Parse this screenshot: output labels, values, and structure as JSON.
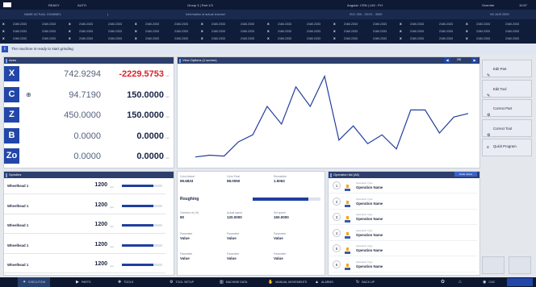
{
  "topbar": {
    "logo": "",
    "mode": "READY",
    "mode2": "AUTO",
    "group": "Group 3 | Part 1/3",
    "angular": "Angular: CRN | LIM : P.H",
    "override": "Override",
    "time": "10:57"
  },
  "subbar": {
    "name_actual": "NAME ACTUAL CHANNEL",
    "sep": "|",
    "info": "Information of actual channel",
    "iso": "ISO: 300 - XXXX - 3000",
    "nc": "NC AUS 0000"
  },
  "channels": {
    "x": "X",
    "value": "2160.2333"
  },
  "message": {
    "icon": "i",
    "text": "The machine is ready to start grinding"
  },
  "axes": {
    "title": "Axes",
    "rows": [
      {
        "label": "X",
        "v1": "742.9294",
        "v2": "-2229.5753",
        "red": true,
        "unit": "mm"
      },
      {
        "label": "C",
        "v1": "94.7190",
        "v2": "150.0000",
        "red": false,
        "unit": "mm",
        "icon": "⊕"
      },
      {
        "label": "Z",
        "v1": "450.0000",
        "v2": "150.0000",
        "red": false,
        "unit": "mm"
      },
      {
        "label": "B",
        "v1": "0.0000",
        "v2": "0.0000",
        "red": false,
        "unit": "mm"
      },
      {
        "label": "Zo",
        "v1": "0.0000",
        "v2": "0.0000",
        "red": false,
        "unit": "mm"
      }
    ]
  },
  "view": {
    "title": "View Options (1 screen)",
    "page": "2/6"
  },
  "chart_data": {
    "type": "line",
    "x": [
      1,
      2,
      3,
      4,
      5,
      6,
      7,
      8,
      9,
      10,
      11,
      12,
      13,
      14,
      15,
      16,
      17,
      18,
      19,
      20
    ],
    "values": [
      3,
      5,
      4,
      20,
      28,
      60,
      40,
      82,
      60,
      94,
      22,
      38,
      18,
      28,
      12,
      56,
      56,
      30,
      48,
      52
    ],
    "ylim": [
      0,
      100
    ]
  },
  "spindles": {
    "title": "Spindles",
    "rows": [
      {
        "name": "Wheelhead 1",
        "value": "1200",
        "unit": "rpm",
        "fill": 0.78
      },
      {
        "name": "Wheelhead 1",
        "value": "1200",
        "unit": "rpm",
        "fill": 0.78
      },
      {
        "name": "Wheelhead 1",
        "value": "1200",
        "unit": "rpm",
        "fill": 0.78
      },
      {
        "name": "Wheelhead 1",
        "value": "1200",
        "unit": "rpm",
        "fill": 0.78
      },
      {
        "name": "Wheelhead 1",
        "value": "1200",
        "unit": "rpm",
        "fill": 0.78
      }
    ]
  },
  "process": {
    "r1": [
      {
        "l": "Color Actual",
        "v": "99.6833"
      },
      {
        "l": "Color Final",
        "v": "98.0050"
      },
      {
        "l": "Remainder",
        "v": "1.5063"
      }
    ],
    "roughing": "Roughing",
    "rough_fill": 0.82,
    "r2": [
      {
        "l": "Overtrav rel (%)",
        "v": "80"
      },
      {
        "l": "Actual speed",
        "v": "120.0000"
      },
      {
        "l": "Set speed",
        "v": "150.0000"
      }
    ],
    "r3": [
      {
        "l": "Parameter",
        "v": "Value"
      },
      {
        "l": "Parameter",
        "v": "Value"
      },
      {
        "l": "Parameter",
        "v": "Value"
      }
    ],
    "r4": [
      {
        "l": "Parameter",
        "v": "Value"
      },
      {
        "l": "Parameter",
        "v": "Value"
      },
      {
        "l": "Parameter",
        "v": "Value"
      }
    ]
  },
  "oplist": {
    "title": "Operation list (All)",
    "badge": "Order active",
    "items": [
      {
        "n": "1",
        "type": "Operation Type",
        "name": "Operation Name"
      },
      {
        "n": "2",
        "type": "Operation Type",
        "name": "Operation Name"
      },
      {
        "n": "3",
        "type": "Operation Type",
        "name": "Operation Name"
      },
      {
        "n": "4",
        "type": "Operation Type",
        "name": "Operation Name"
      },
      {
        "n": "5",
        "type": "Operation Type",
        "name": "Operation Name"
      },
      {
        "n": "6",
        "type": "Operation Type",
        "name": "Operation Name"
      }
    ]
  },
  "right": [
    "Edit Part",
    "Edit Tool",
    "Correct Part",
    "Correct Tool",
    "Quick Program"
  ],
  "bottom": [
    "EXECUTION",
    "PARTS",
    "TOOLS",
    "TOOL SETUP",
    "MACHINE DATA",
    "MANUAL MOVEMENTS",
    "ALARMS",
    "BACK UP",
    "CNC"
  ],
  "colors": {
    "accent": "#2347a8",
    "red": "#d8232a",
    "dark": "#0e1a33"
  }
}
